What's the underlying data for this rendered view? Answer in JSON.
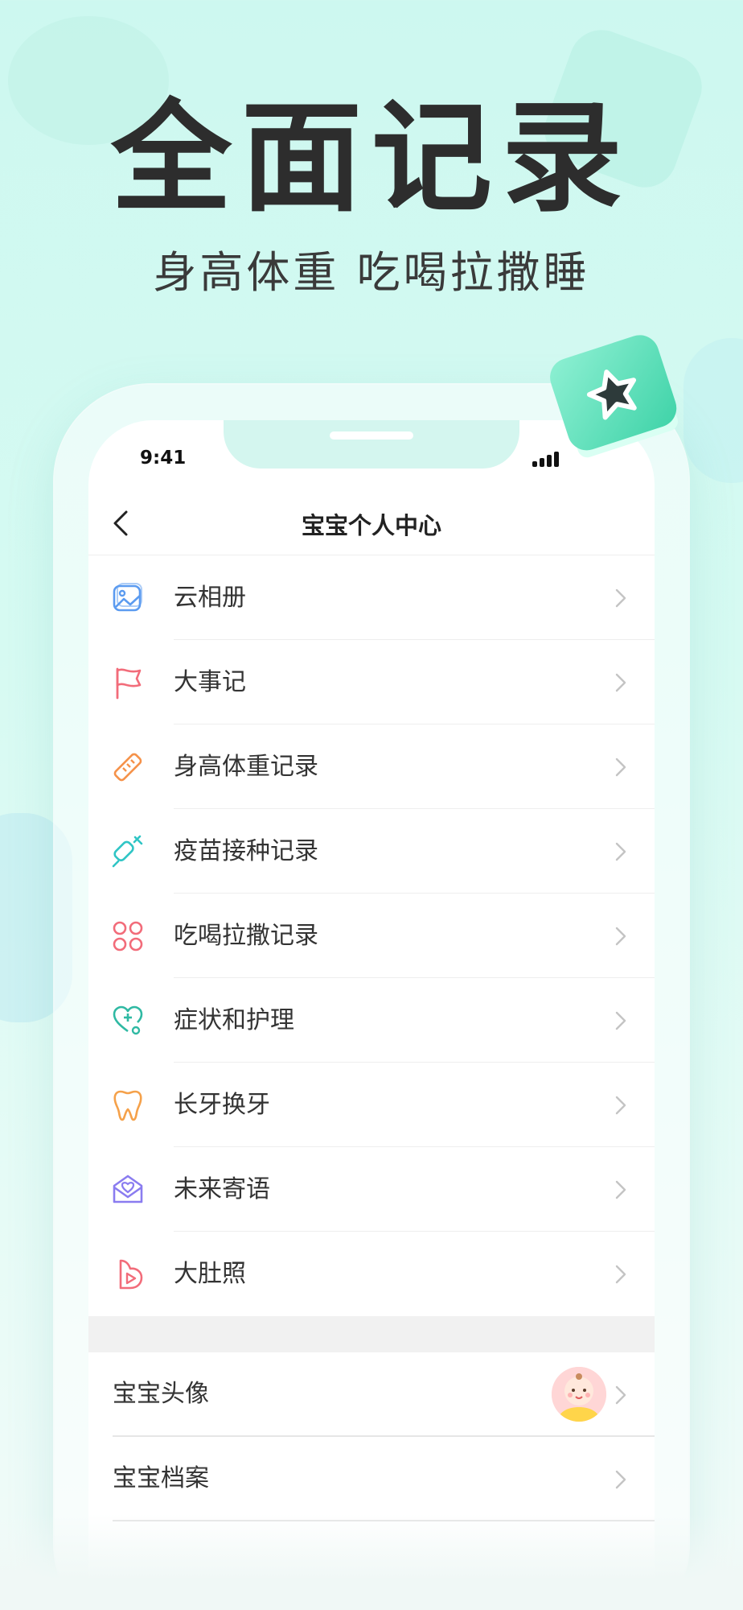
{
  "hero": {
    "title": "全面记录",
    "subtitle": "身高体重 吃喝拉撒睡"
  },
  "status_bar": {
    "time": "9:41"
  },
  "nav": {
    "title": "宝宝个人中心",
    "back_icon": "chevron-left-icon"
  },
  "menu": {
    "items": [
      {
        "label": "云相册",
        "icon": "photo-album-icon",
        "color": "#5b9bf0"
      },
      {
        "label": "大事记",
        "icon": "flag-icon",
        "color": "#f26c7a"
      },
      {
        "label": "身高体重记录",
        "icon": "ruler-icon",
        "color": "#f5924a"
      },
      {
        "label": "疫苗接种记录",
        "icon": "syringe-icon",
        "color": "#2fc5c5"
      },
      {
        "label": "吃喝拉撒记录",
        "icon": "four-circles-icon",
        "color": "#f26c7a"
      },
      {
        "label": "症状和护理",
        "icon": "heart-stethoscope-icon",
        "color": "#2fb9a3"
      },
      {
        "label": "长牙换牙",
        "icon": "tooth-icon",
        "color": "#f5a14a"
      },
      {
        "label": "未来寄语",
        "icon": "heart-envelope-icon",
        "color": "#8a7cf0"
      },
      {
        "label": "大肚照",
        "icon": "pregnant-play-icon",
        "color": "#f26c7a"
      }
    ]
  },
  "profile": {
    "items": [
      {
        "label": "宝宝头像",
        "has_avatar": true
      },
      {
        "label": "宝宝档案",
        "has_avatar": false
      }
    ]
  },
  "theme": {
    "accent": "#6fe3c4",
    "chevron": "#c4c4c4",
    "text": "#333333"
  }
}
